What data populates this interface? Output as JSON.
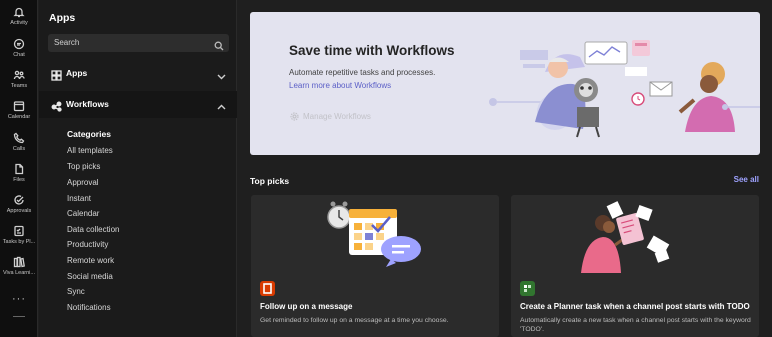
{
  "rail": {
    "items": [
      {
        "label": "Activity",
        "icon": "bell-icon"
      },
      {
        "label": "Chat",
        "icon": "chat-icon"
      },
      {
        "label": "Teams",
        "icon": "teams-icon"
      },
      {
        "label": "Calendar",
        "icon": "calendar-icon"
      },
      {
        "label": "Calls",
        "icon": "phone-icon"
      },
      {
        "label": "Files",
        "icon": "file-icon"
      },
      {
        "label": "Approvals",
        "icon": "approvals-icon"
      },
      {
        "label": "Tasks by Pl...",
        "icon": "tasks-icon"
      },
      {
        "label": "Viva Learni...",
        "icon": "books-icon"
      }
    ],
    "more": "···"
  },
  "panel": {
    "title": "Apps",
    "search_placeholder": "Search",
    "sections": [
      {
        "label": "Apps"
      },
      {
        "label": "Workflows"
      }
    ],
    "categories_heading": "Categories",
    "categories": [
      "All templates",
      "Top picks",
      "Approval",
      "Instant",
      "Calendar",
      "Data collection",
      "Productivity",
      "Remote work",
      "Social media",
      "Sync",
      "Notifications"
    ]
  },
  "hero": {
    "title": "Save time with Workflows",
    "subtitle": "Automate repetitive tasks and processes.",
    "link": "Learn more about Workflows",
    "manage": "Manage Workflows"
  },
  "main": {
    "top_picks": "Top picks",
    "see_all": "See all"
  },
  "cards": [
    {
      "title": "Follow up on a message",
      "description": "Get reminded to follow up on a message at a time you choose.",
      "app_icon": "office-icon",
      "app_color": "#d83b01"
    },
    {
      "title": "Create a Planner task when a channel post starts with TODO",
      "description": "Automatically create a new task when a channel post starts with the keyword 'TODO'.",
      "app_icon": "planner-icon",
      "app_color": "#31752f"
    }
  ],
  "colors": {
    "accent": "#5b5fc7",
    "link_dark": "#9ea2ff",
    "hero_bg": "#e3e3ef"
  }
}
